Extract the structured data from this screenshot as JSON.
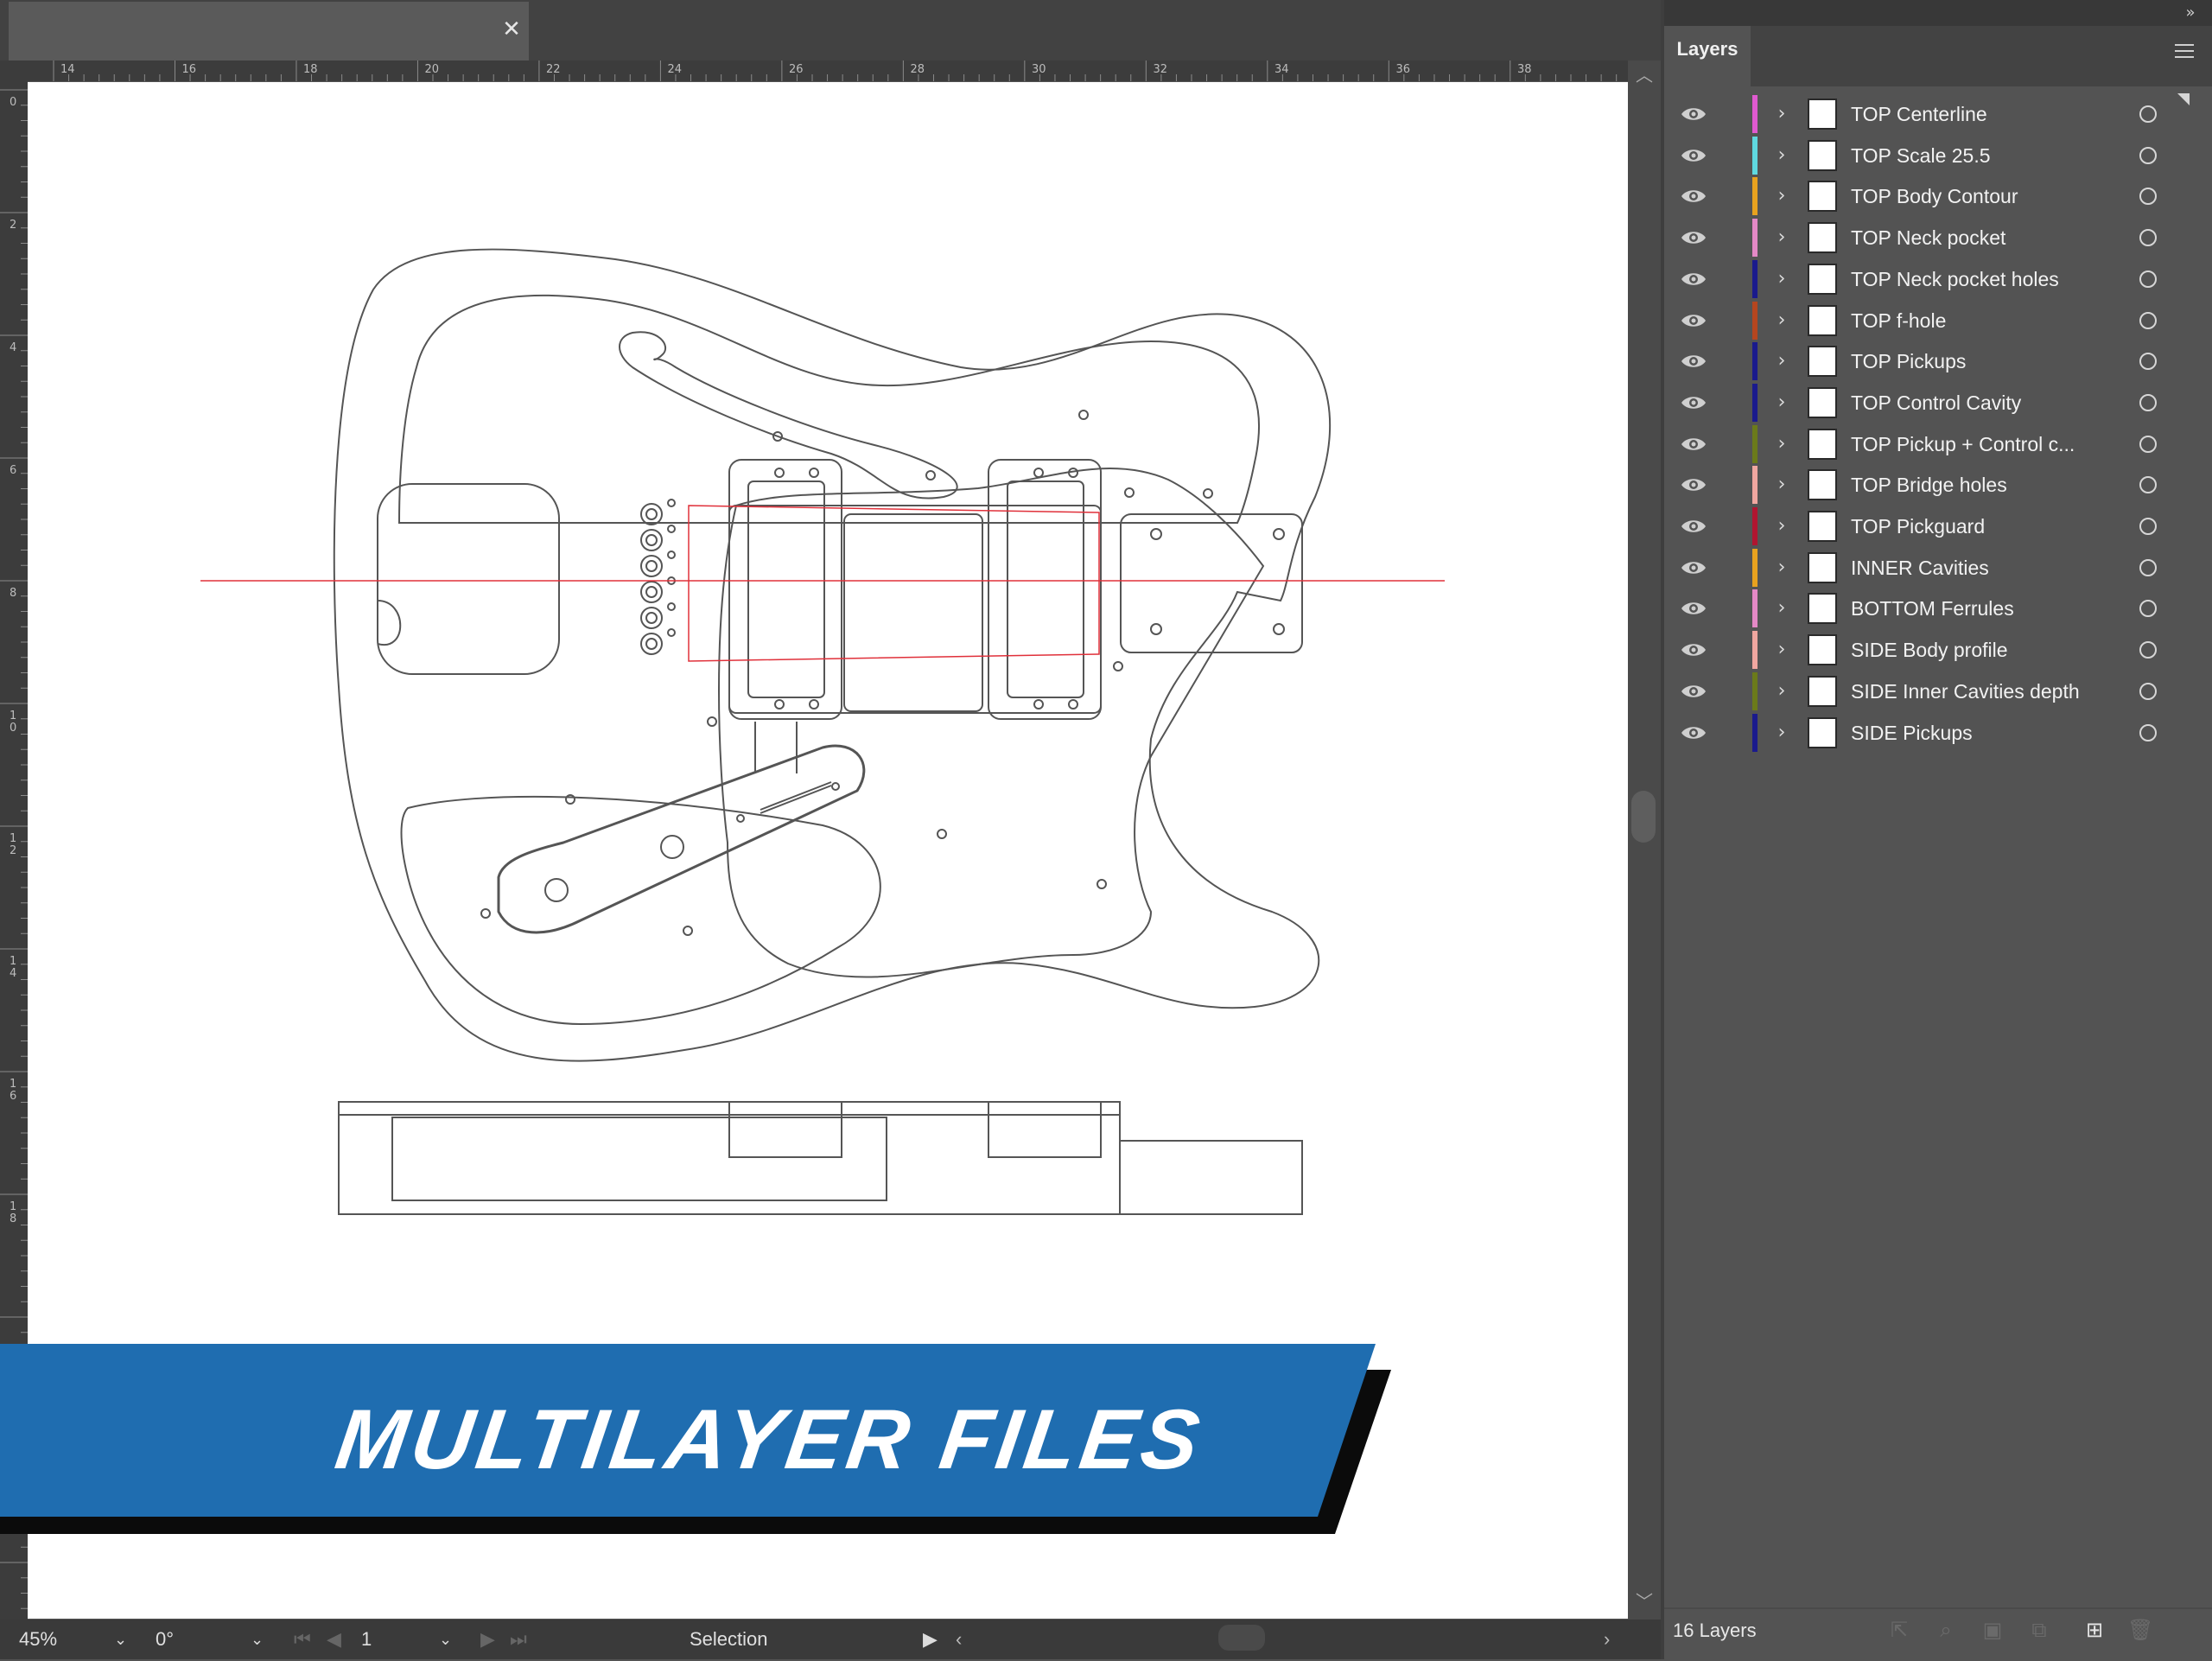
{
  "document": {
    "tab_close_icon": "close-icon"
  },
  "rulers": {
    "top_ticks": [
      "14",
      "16",
      "18",
      "20",
      "22",
      "24",
      "26",
      "28",
      "30",
      "32",
      "34",
      "36",
      "38"
    ],
    "left_ticks": [
      "0",
      "2",
      "4",
      "6",
      "8",
      "1\n0",
      "1\n2",
      "1\n4",
      "1\n6",
      "1\n8"
    ]
  },
  "banner": {
    "text": "MULTILAYER FILES",
    "color": "#1f6db0"
  },
  "status_bar": {
    "zoom": "45%",
    "rotation": "0°",
    "artboard": "1",
    "tool": "Selection"
  },
  "layers_panel": {
    "tab_label": "Layers",
    "footer_count": "16 Layers",
    "layers": [
      {
        "name": "TOP Centerline",
        "color": "#e05ad0"
      },
      {
        "name": "TOP Scale 25.5",
        "color": "#5fd9e0"
      },
      {
        "name": "TOP Body Contour",
        "color": "#e8a21f"
      },
      {
        "name": "TOP Neck pocket",
        "color": "#e489c6"
      },
      {
        "name": "TOP Neck pocket holes",
        "color": "#1a1a8c"
      },
      {
        "name": "TOP f-hole",
        "color": "#b5461f"
      },
      {
        "name": "TOP Pickups",
        "color": "#1a1a8c"
      },
      {
        "name": "TOP Control Cavity",
        "color": "#1a1a8c"
      },
      {
        "name": "TOP Pickup + Control c...",
        "color": "#6b7a1a"
      },
      {
        "name": "TOP Bridge holes",
        "color": "#f0a7a0"
      },
      {
        "name": "TOP Pickguard",
        "color": "#b01530"
      },
      {
        "name": "INNER Cavities",
        "color": "#e8a21f"
      },
      {
        "name": "BOTTOM Ferrules",
        "color": "#e489c6"
      },
      {
        "name": "SIDE Body profile",
        "color": "#f0a7a0"
      },
      {
        "name": "SIDE Inner Cavities depth",
        "color": "#6b7a1a"
      },
      {
        "name": "SIDE Pickups",
        "color": "#1a1a8c"
      }
    ]
  }
}
